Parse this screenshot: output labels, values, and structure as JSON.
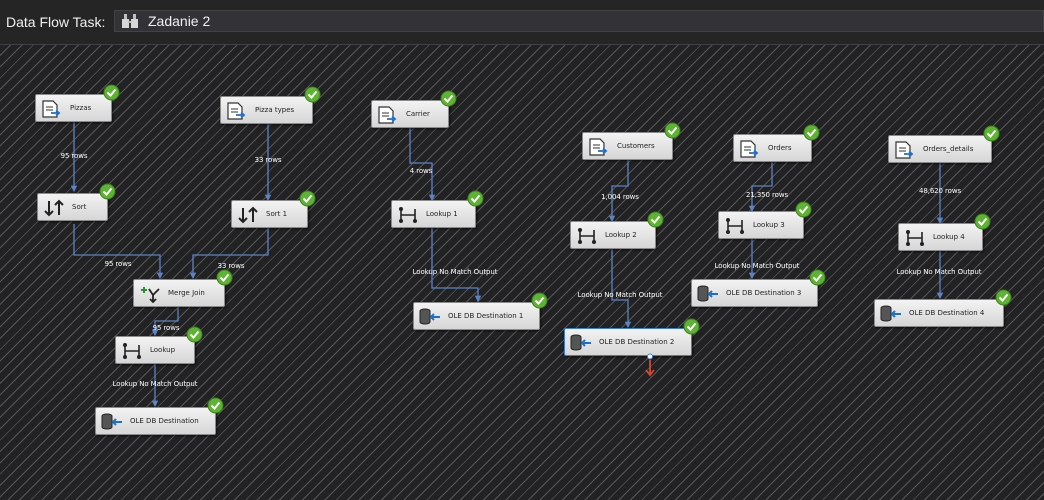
{
  "header": {
    "label": "Data Flow Task:",
    "selected_task": "Zadanie 2",
    "task_icon": "task-icon"
  },
  "colors": {
    "canvas": "#222224",
    "hatch": "#969696",
    "path": "#5b84c4",
    "success": "#5fb332",
    "selection": "#3b7ddd"
  },
  "components": {
    "pizzas": "Pizzas",
    "pizza_types": "Pizza types",
    "carrier": "Carrier",
    "customers": "Customers",
    "orders": "Orders",
    "orders_details": "Orders_details",
    "sort": "Sort",
    "sort_1": "Sort 1",
    "merge_join": "Merge Join",
    "lookup": "Lookup",
    "lookup_1": "Lookup 1",
    "lookup_2": "Lookup 2",
    "lookup_3": "Lookup 3",
    "lookup_4": "Lookup 4",
    "ole_dest": "OLE DB Destination",
    "ole_dest_1": "OLE DB Destination 1",
    "ole_dest_2": "OLE DB Destination 2",
    "ole_dest_3": "OLE DB Destination 3",
    "ole_dest_4": "OLE DB Destination 4"
  },
  "paths": {
    "pizzas_sort": "95 rows",
    "sort_merge": "95 rows",
    "pizzatypes_sort1": "33 rows",
    "sort1_merge": "33 rows",
    "merge_lookup": "95 rows",
    "lookup_dest": "Lookup No Match Output",
    "carrier_lookup1": "4 rows",
    "lookup1_dest1": "Lookup No Match Output",
    "customers_lookup2": "1,004 rows",
    "lookup2_dest2": "Lookup No Match Output",
    "orders_lookup3": "21,350 rows",
    "lookup3_dest3": "Lookup No Match Output",
    "ordersdetails_lookup4": "48,620 rows",
    "lookup4_dest4": "Lookup No Match Output"
  }
}
